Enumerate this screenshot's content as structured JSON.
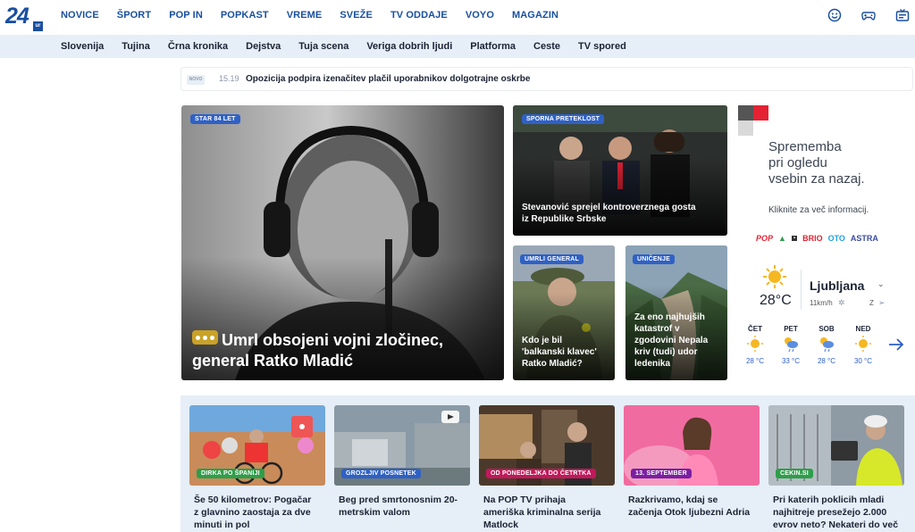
{
  "logo": {
    "number": "24",
    "sub": "ur"
  },
  "main_nav": [
    "NOVICE",
    "ŠPORT",
    "POP IN",
    "POPKAST",
    "VREME",
    "SVEŽE",
    "TV ODDAJE",
    "VOYO",
    "MAGAZIN"
  ],
  "top_icons": [
    "smiley-icon",
    "gamepad-icon",
    "tv-icon"
  ],
  "sub_nav": [
    "Slovenija",
    "Tujina",
    "Črna kronika",
    "Dejstva",
    "Tuja scena",
    "Veriga dobrih ljudi",
    "Platforma",
    "Ceste",
    "TV spored"
  ],
  "ticker": {
    "badge": "NOVO",
    "time": "15.19",
    "text": "Opozicija podpira izenačitev plačil uporabnikov dolgotrajne oskrbe"
  },
  "lead": {
    "badge": "STAR 84 LET",
    "title_line1": "Umrl obsojeni vojni zločinec,",
    "title_line2": "general Ratko Mladić"
  },
  "side_top": {
    "badge": "SPORNA PRETEKLOST",
    "title_line1": "Stevanović sprejel kontroverznega gosta",
    "title_line2": "iz Republike Srbske"
  },
  "small1": {
    "badge": "UMRLI GENERAL",
    "lines": [
      "Kdo je bil",
      "'balkanski klavec'",
      "Ratko Mladić?"
    ]
  },
  "small2": {
    "badge": "UNIČENJE",
    "lines": [
      "Za eno najhujših",
      "katastrof v",
      "zgodovini Nepala",
      "kriv (tudi) udor",
      "ledenika"
    ]
  },
  "ad": {
    "line1": "Sprememba",
    "line2": "pri ogledu",
    "line3": "vsebin za nazaj.",
    "sub": "Kliknite za več informacij."
  },
  "brands": [
    "POP",
    "KANAL A",
    "OTO",
    "BRIO",
    "OTO",
    "ASTRA"
  ],
  "weather": {
    "temp": "28°C",
    "city": "Ljubljana",
    "wind": "11km/h",
    "dir": "Z",
    "days": [
      {
        "day": "ČET",
        "temp": "28 °C",
        "icon": "sun-icon"
      },
      {
        "day": "PET",
        "temp": "33 °C",
        "icon": "sun-cloud-rain-icon"
      },
      {
        "day": "SOB",
        "temp": "28 °C",
        "icon": "sun-cloud-rain-icon"
      },
      {
        "day": "NED",
        "temp": "30 °C",
        "icon": "sun-icon"
      }
    ]
  },
  "bottom": [
    {
      "badge": "DIRKA PO ŠPANIJI",
      "badge_color": "#2e9e4a",
      "lines": [
        "Še 50 kilometrov: Pogačar",
        "z glavnino zaostaja za dve",
        "minuti in pol"
      ]
    },
    {
      "badge": "GROZLJIV POSNETEK",
      "badge_color": "#2f61c5",
      "lines": [
        "Beg pred smrtonosnim 20-",
        "metrskim valom"
      ]
    },
    {
      "badge": "OD PONEDELJKA DO ČETRTKA",
      "badge_color": "#c2185b",
      "lines": [
        "Na POP TV prihaja",
        "ameriška kriminalna serija",
        "Matlock"
      ]
    },
    {
      "badge": "13. SEPTEMBER",
      "badge_color": "#7a1fa2",
      "lines": [
        "Razkrivamo, kdaj se",
        "začenja Otok ljubezni Adria"
      ]
    },
    {
      "badge": "CEKIN.SI",
      "badge_color": "#2e9e4a",
      "lines": [
        "Pri katerih poklicih mladi",
        "najhitreje presežejo 2.000",
        "evrov neto? Nekateri do več"
      ]
    }
  ]
}
